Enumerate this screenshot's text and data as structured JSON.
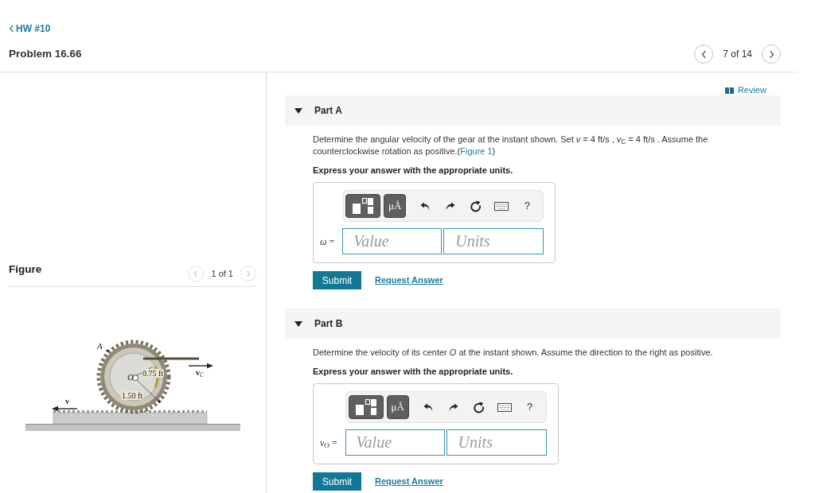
{
  "header": {
    "back_link": "HW #10",
    "title": "Problem 16.66",
    "pager": {
      "prev": {
        "disabled": false
      },
      "position": "7 of 14",
      "next": {
        "disabled": false
      }
    }
  },
  "figure_panel": {
    "title": "Figure",
    "pager": {
      "prev": {
        "disabled": true
      },
      "position": "1 of 1",
      "next": {
        "disabled": true
      }
    },
    "labels": [
      {
        "kind": "point",
        "text": "A"
      },
      {
        "kind": "point",
        "text": "O"
      },
      {
        "kind": "dimension",
        "text": "0.75 ft"
      },
      {
        "kind": "dimension",
        "text": "1.50 ft"
      },
      {
        "kind": "vector",
        "text": "v"
      },
      {
        "kind": "vector",
        "text": "v$_{C}$"
      }
    ]
  },
  "review_link": "Review",
  "parts": [
    {
      "title": "Part A",
      "expanded": true,
      "prompt": {
        "text": "Determine the angular velocity of the gear at the instant shown. Set *v* = 4 ft/s , *v*$_{C}$ = 4 ft/s . Assume the counterclockwise rotation as positive.(",
        "link": "Figure 1",
        "text_after": ")"
      },
      "instruction": "Express your answer with the appropriate units.",
      "toolbar": {
        "units_button": "μÅ",
        "help_button": "?"
      },
      "answer_label": "*ω* =",
      "value_placeholder": "Value",
      "units_placeholder": "Units",
      "submit": "Submit",
      "request_answer": "Request Answer"
    },
    {
      "title": "Part B",
      "expanded": true,
      "prompt": {
        "text": "Determine the velocity of its center *O* at the instant shown. Assume the direction to the right as positive."
      },
      "instruction": "Express your answer with the appropriate units.",
      "toolbar": {
        "units_button": "μÅ",
        "help_button": "?"
      },
      "answer_label": "*v*$_{O}$ =",
      "value_placeholder": "Value",
      "units_placeholder": "Units",
      "submit": "Submit",
      "request_answer": "Request Answer"
    }
  ]
}
